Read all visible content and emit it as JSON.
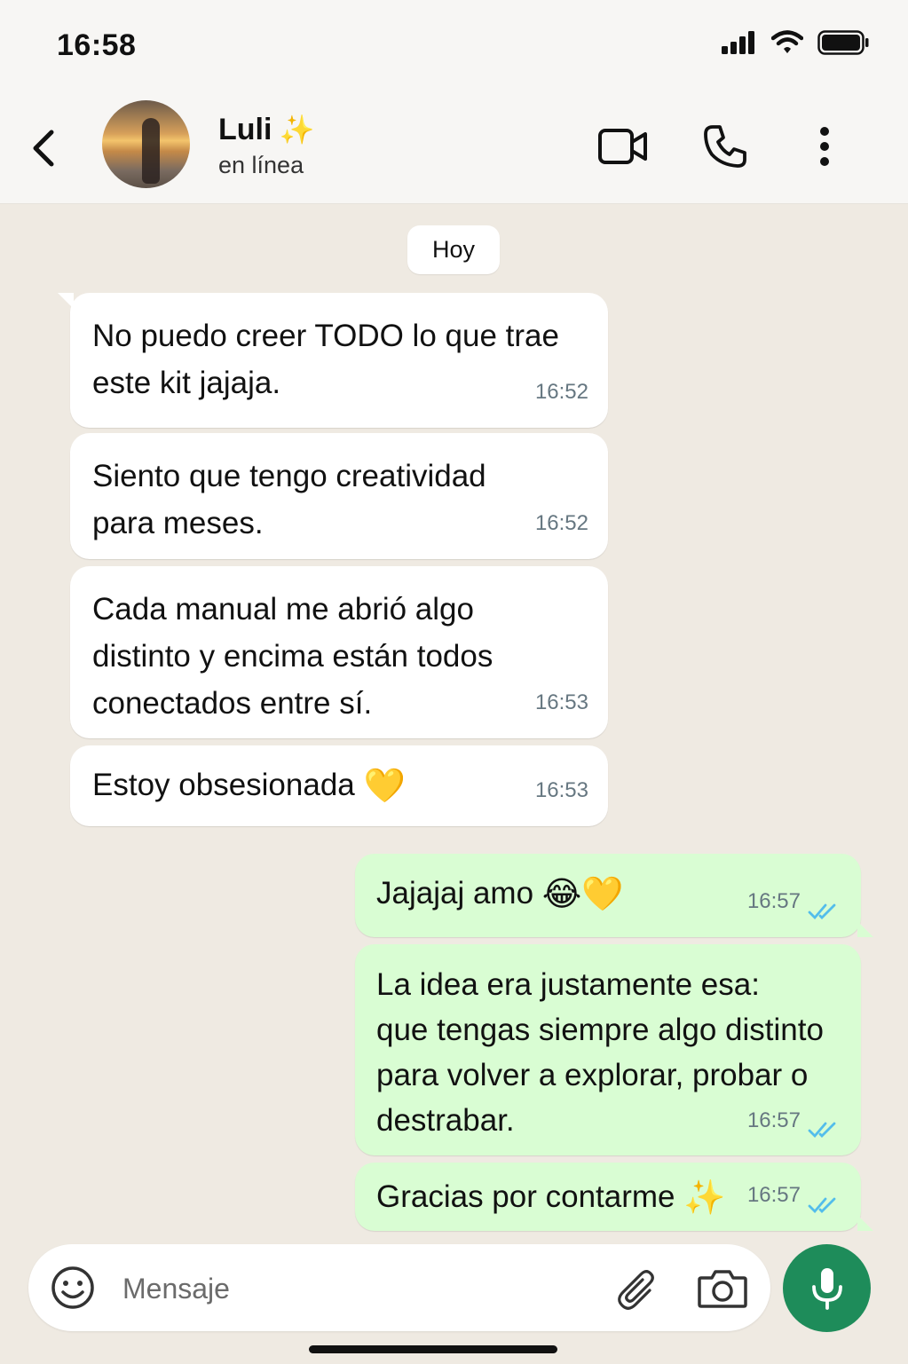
{
  "status_bar": {
    "time": "16:58"
  },
  "header": {
    "contact_name": "Luli",
    "name_emoji": "✨",
    "contact_status": "en línea"
  },
  "chat": {
    "date_chip": "Hoy",
    "messages": [
      {
        "dir": "in",
        "lines": [
          "No puedo creer TODO lo que trae",
          "este kit jajaja."
        ],
        "time": "16:52"
      },
      {
        "dir": "in",
        "lines": [
          "Siento que tengo creatividad",
          "para meses."
        ],
        "time": "16:52"
      },
      {
        "dir": "in",
        "lines": [
          "Cada manual me abrió algo",
          "distinto y encima están todos",
          "conectados entre sí."
        ],
        "time": "16:53"
      },
      {
        "dir": "in",
        "text": "Estoy obsesionada",
        "emoji": "💛",
        "time": "16:53"
      },
      {
        "dir": "out",
        "text": "Jajajaj amo",
        "emoji": "😂💛",
        "time": "16:57",
        "status": "read"
      },
      {
        "dir": "out",
        "lines": [
          "La idea era justamente esa:",
          "que tengas siempre algo distinto",
          "para volver a explorar, probar o",
          "destrabar."
        ],
        "time": "16:57",
        "status": "read"
      },
      {
        "dir": "out",
        "text": "Gracias por contarme",
        "emoji": "✨",
        "time": "16:57",
        "status": "read"
      }
    ]
  },
  "composer": {
    "placeholder": "Mensaje"
  },
  "colors": {
    "outgoing_bubble": "#d9fdd3",
    "incoming_bubble": "#ffffff",
    "read_ticks": "#53bdeb",
    "mic_button": "#1e8c5a",
    "chat_bg": "#efeae2"
  },
  "icons": [
    "back-arrow-icon",
    "video-call-icon",
    "phone-icon",
    "more-vertical-icon",
    "emoji-icon",
    "attach-icon",
    "camera-icon",
    "mic-icon",
    "double-check-icon"
  ]
}
